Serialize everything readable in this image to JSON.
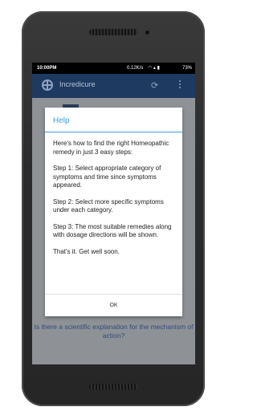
{
  "status_bar": {
    "time": "10:00PM",
    "network_speed": "0.12K/s",
    "battery": "73%"
  },
  "app_bar": {
    "title": "Incredicure",
    "icons": [
      "app-logo-icon",
      "refresh-icon",
      "overflow-menu-icon"
    ]
  },
  "background": {
    "question_1": "Is there a scientific explanation for the mechanism of action?"
  },
  "dialog": {
    "title": "Help",
    "paragraphs": [
      "Here's how to find the right Homeopathic remedy in just 3 easy steps:",
      "Step 1: Select appropriate category of symptoms and time since symptoms appeared.",
      "Step 2: Select more specific symptoms under each category.",
      "Step 3: The most suitable remedies along with dosage directions will be shown.",
      "That's it. Get well soon."
    ],
    "ok_label": "OK"
  },
  "colors": {
    "app_bar": "#1e3a61",
    "accent": "#3aa2d6",
    "dim_background": "#8e9297"
  }
}
